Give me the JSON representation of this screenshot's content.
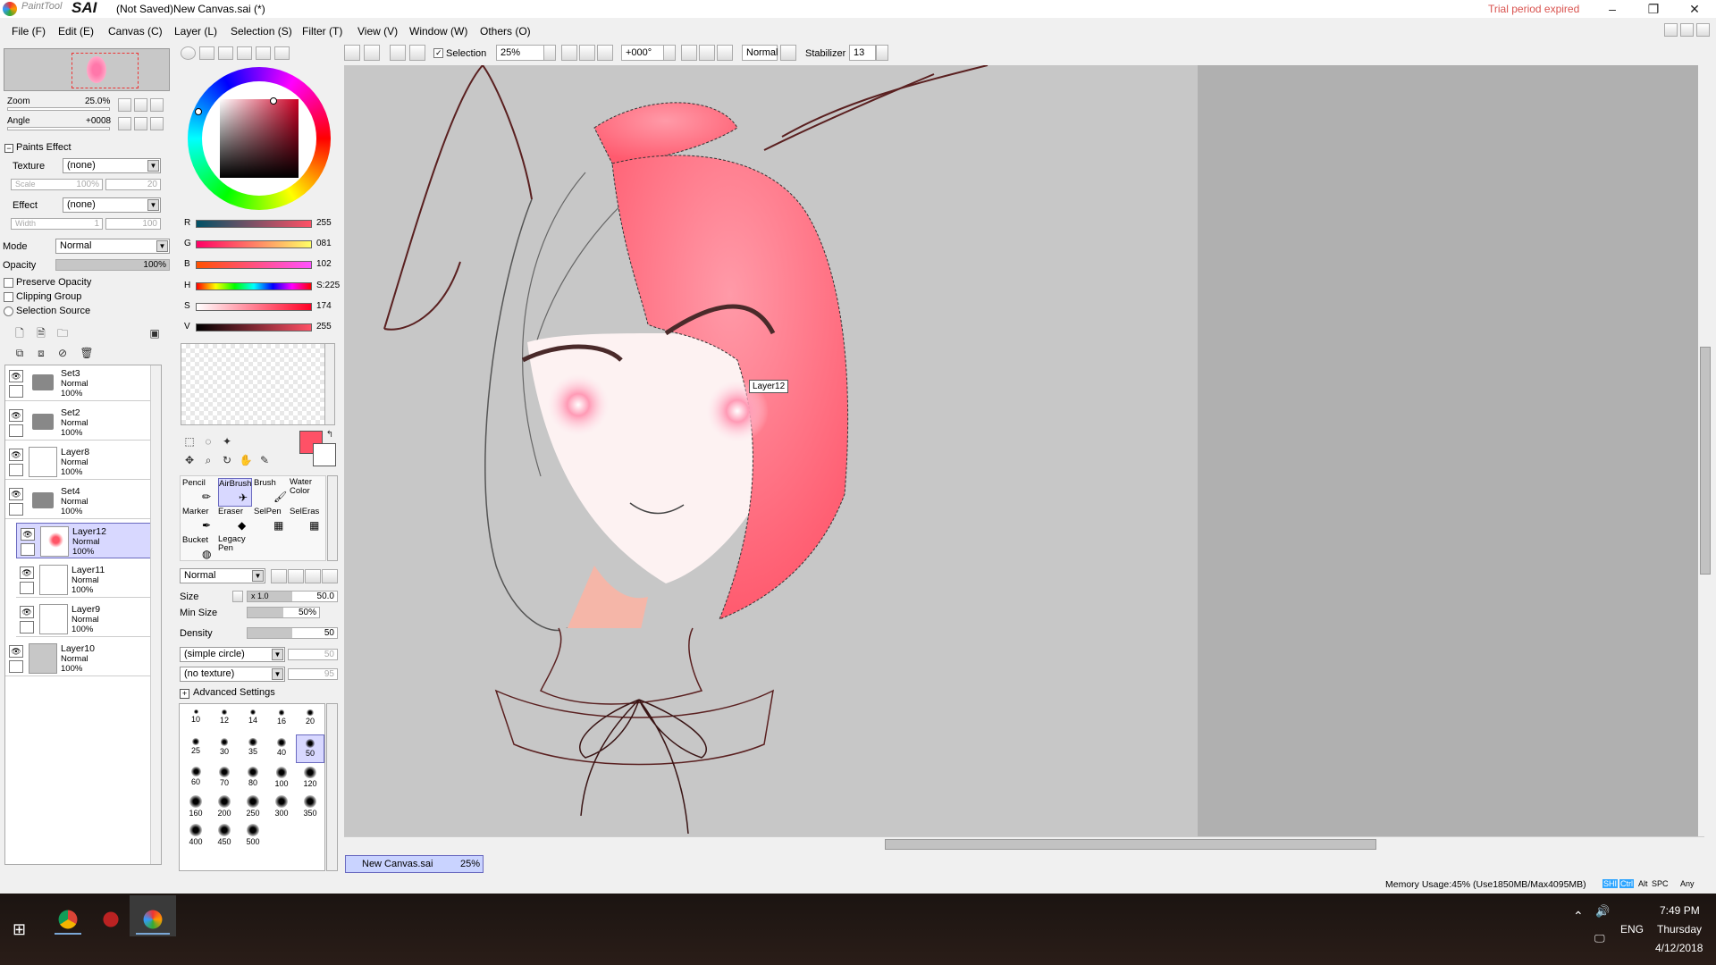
{
  "titlebar": {
    "app_name_small": "PaintTool",
    "app_name_big": "SAI",
    "document_title": "(Not Saved)New Canvas.sai (*)",
    "trial_notice": "Trial period expired",
    "minimize": "–",
    "restore": "❐",
    "close": "✕"
  },
  "menu": [
    {
      "label": "File (F)"
    },
    {
      "label": "Edit (E)"
    },
    {
      "label": "Canvas (C)"
    },
    {
      "label": "Layer (L)"
    },
    {
      "label": "Selection (S)"
    },
    {
      "label": "Filter (T)"
    },
    {
      "label": "View (V)"
    },
    {
      "label": "Window (W)"
    },
    {
      "label": "Others (O)"
    }
  ],
  "toolbar": {
    "selection_label": "Selection",
    "selection_checked": true,
    "zoom_value": "25%",
    "angle_value": "+000°",
    "mode_value": "Normal",
    "stabilizer_label": "Stabilizer",
    "stabilizer_value": "13"
  },
  "navigator": {
    "zoom_label": "Zoom",
    "zoom_value": "25.0%",
    "angle_label": "Angle",
    "angle_value": "+0008"
  },
  "paints_effect": {
    "header": "Paints Effect",
    "texture_label": "Texture",
    "texture_value": "(none)",
    "scale_label": "Scale",
    "scale_value": "100%",
    "scale_num": "20",
    "effect_label": "Effect",
    "effect_value": "(none)",
    "width_label": "Width",
    "width_value": "1",
    "width_num": "100"
  },
  "layer_props": {
    "mode_label": "Mode",
    "mode_value": "Normal",
    "opacity_label": "Opacity",
    "opacity_value": "100%",
    "preserve_opacity": "Preserve Opacity",
    "clipping_group": "Clipping Group",
    "selection_source": "Selection Source"
  },
  "layers": [
    {
      "name": "Set3",
      "mode": "Normal",
      "opacity": "100%",
      "type": "folder",
      "selected": false
    },
    {
      "name": "Set2",
      "mode": "Normal",
      "opacity": "100%",
      "type": "folder",
      "selected": false
    },
    {
      "name": "Layer8",
      "mode": "Normal",
      "opacity": "100%",
      "type": "layer",
      "selected": false
    },
    {
      "name": "Set4",
      "mode": "Normal",
      "opacity": "100%",
      "type": "folder",
      "selected": false
    },
    {
      "name": "Layer12",
      "mode": "Normal",
      "opacity": "100%",
      "type": "layer",
      "selected": true
    },
    {
      "name": "Layer11",
      "mode": "Normal",
      "opacity": "100%",
      "type": "layer",
      "selected": false
    },
    {
      "name": "Layer9",
      "mode": "Normal",
      "opacity": "100%",
      "type": "layer",
      "selected": false
    },
    {
      "name": "Layer10",
      "mode": "Normal",
      "opacity": "100%",
      "type": "layer",
      "selected": false
    }
  ],
  "color": {
    "primary": "#ff5166",
    "secondary": "#ffffff",
    "sliders": [
      {
        "label": "R",
        "value": "255",
        "pos": 1.0
      },
      {
        "label": "G",
        "value": "081",
        "pos": 0.32
      },
      {
        "label": "B",
        "value": "102",
        "pos": 0.4
      },
      {
        "label": "H",
        "value": "S:225",
        "pos": 0.98
      },
      {
        "label": "S",
        "value": "174",
        "pos": 0.68
      },
      {
        "label": "V",
        "value": "255",
        "pos": 1.0
      }
    ]
  },
  "tools": [
    {
      "label": "Pencil",
      "selected": false
    },
    {
      "label": "AirBrush",
      "selected": true
    },
    {
      "label": "Brush",
      "selected": false
    },
    {
      "label": "Water Color",
      "selected": false
    },
    {
      "label": "Marker",
      "selected": false
    },
    {
      "label": "Eraser",
      "selected": false
    },
    {
      "label": "SelPen",
      "selected": false
    },
    {
      "label": "SelEras",
      "selected": false
    },
    {
      "label": "Bucket",
      "selected": false
    },
    {
      "label": "Legacy Pen",
      "selected": false
    }
  ],
  "brush": {
    "mode_value": "Normal",
    "size_label": "Size",
    "size_mult": "x 1.0",
    "size_value": "50.0",
    "minsize_label": "Min Size",
    "minsize_value": "50%",
    "density_label": "Density",
    "density_value": "50",
    "shape_value": "(simple circle)",
    "shape_num": "50",
    "texture_value": "(no texture)",
    "texture_num": "95",
    "advanced": "Advanced Settings",
    "sizes": [
      "10",
      "12",
      "14",
      "16",
      "20",
      "25",
      "30",
      "35",
      "40",
      "50",
      "60",
      "70",
      "80",
      "100",
      "120",
      "160",
      "200",
      "250",
      "300",
      "350",
      "400",
      "450",
      "500"
    ],
    "selected_size": "50"
  },
  "canvas": {
    "tooltip": "Layer12"
  },
  "doc_tab": {
    "name": "New Canvas.sai",
    "zoom": "25%"
  },
  "status": {
    "memory": "Memory Usage:45% (Use1850MB/Max4095MB)",
    "keys": [
      "SHI",
      "Ctrl",
      "Alt",
      "SPC",
      "Any"
    ]
  },
  "taskbar": {
    "time": "7:49 PM",
    "day": "Thursday",
    "date": "4/12/2018",
    "lang": "ENG"
  }
}
